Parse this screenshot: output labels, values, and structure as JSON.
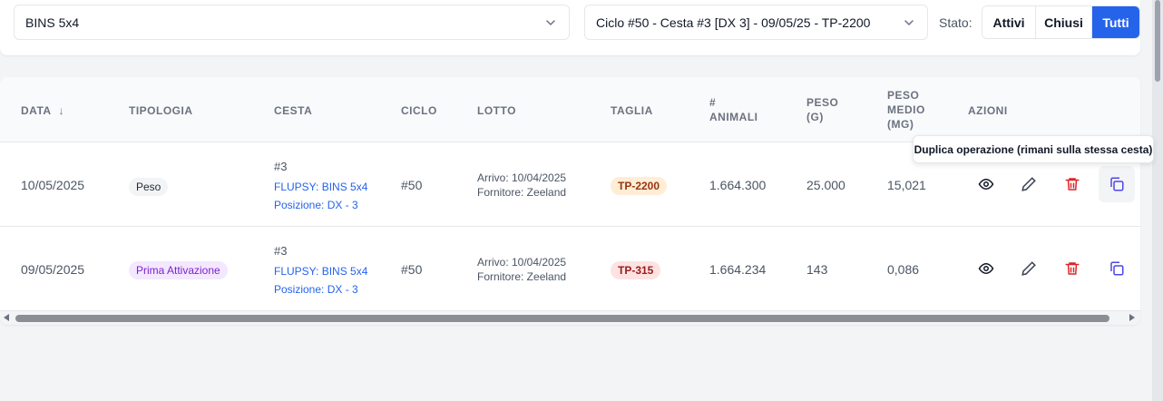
{
  "filters": {
    "basket_select": "BINS 5x4",
    "cycle_select": "Ciclo #50 - Cesta #3 [DX 3] - 09/05/25 - TP-2200",
    "stato_label": "Stato:",
    "stato_options": [
      "Attivi",
      "Chiusi",
      "Tutti"
    ],
    "stato_selected": "Tutti"
  },
  "table": {
    "headers": {
      "data": "DATA",
      "tipologia": "TIPOLOGIA",
      "cesta": "CESTA",
      "ciclo": "CICLO",
      "lotto": "LOTTO",
      "taglia": "TAGLIA",
      "animali_l1": "#",
      "animali_l2": "ANIMALI",
      "peso_l1": "PESO",
      "peso_l2": "(G)",
      "medio_l1": "PESO",
      "medio_l2": "MEDIO",
      "medio_l3": "(MG)",
      "azioni": "AZIONI"
    },
    "sort_icon": "arrow-down-icon",
    "rows": [
      {
        "data": "10/05/2025",
        "tipologia": "Peso",
        "cesta_num": "#3",
        "flupsy": "FLUPSY: BINS 5x4",
        "posizione": "Posizione: DX - 3",
        "ciclo": "#50",
        "arrivo": "Arrivo: 10/04/2025",
        "fornitore": "Fornitore: Zeeland",
        "taglia": "TP-2200",
        "animali": "1.664.300",
        "peso": "25.000",
        "peso_medio": "15,021"
      },
      {
        "data": "09/05/2025",
        "tipologia": "Prima Attivazione",
        "cesta_num": "#3",
        "flupsy": "FLUPSY: BINS 5x4",
        "posizione": "Posizione: DX - 3",
        "ciclo": "#50",
        "arrivo": "Arrivo: 10/04/2025",
        "fornitore": "Fornitore: Zeeland",
        "taglia": "TP-315",
        "animali": "1.664.234",
        "peso": "143",
        "peso_medio": "0,086"
      }
    ],
    "action_icons": [
      "eye-icon",
      "pencil-icon",
      "trash-icon",
      "copy-icon"
    ]
  },
  "tooltip": "Duplica operazione (rimani sulla stessa cesta)",
  "colors": {
    "accent": "#2563eb",
    "danger": "#dc2626",
    "purple": "#7e22ce"
  }
}
